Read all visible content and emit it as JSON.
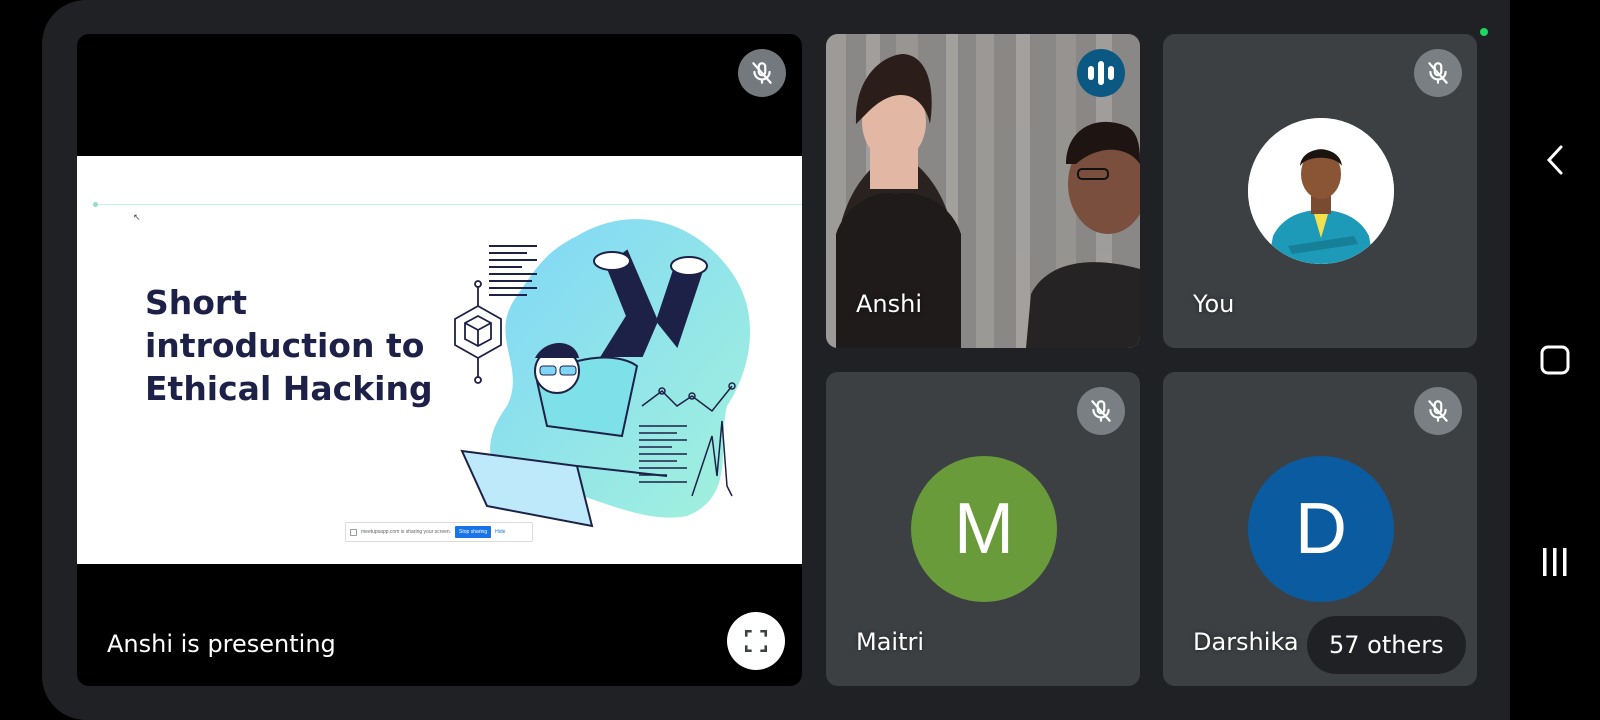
{
  "colors": {
    "app_background": "#202124",
    "tile_background": "#3c4043",
    "speaking_badge": "#0b5882",
    "avatar_maitri": "#699b3a",
    "avatar_darshika": "#0b5ba1",
    "slide_title": "#1d2147"
  },
  "presentation": {
    "presenter_label": "Anshi is presenting",
    "mic_icon": "mic-off-icon",
    "fullscreen_icon": "fullscreen-icon",
    "slide": {
      "title": "Short introduction to Ethical Hacking",
      "share_bar": {
        "text": "meetupsapp.com is sharing your screen.",
        "stop_label": "Stop sharing",
        "hide_label": "Hide"
      }
    }
  },
  "participants": [
    {
      "name": "Anshi",
      "status_icon": "speaking-icon"
    },
    {
      "name": "You",
      "status_icon": "mic-off-icon"
    },
    {
      "name": "Maitri",
      "initial": "M",
      "status_icon": "mic-off-icon"
    },
    {
      "name": "Darshika",
      "initial": "D",
      "status_icon": "mic-off-icon"
    }
  ],
  "others_count_label": "57 others",
  "android_nav": {
    "back_icon": "back-icon",
    "home_icon": "home-icon",
    "recents_icon": "recents-icon"
  }
}
